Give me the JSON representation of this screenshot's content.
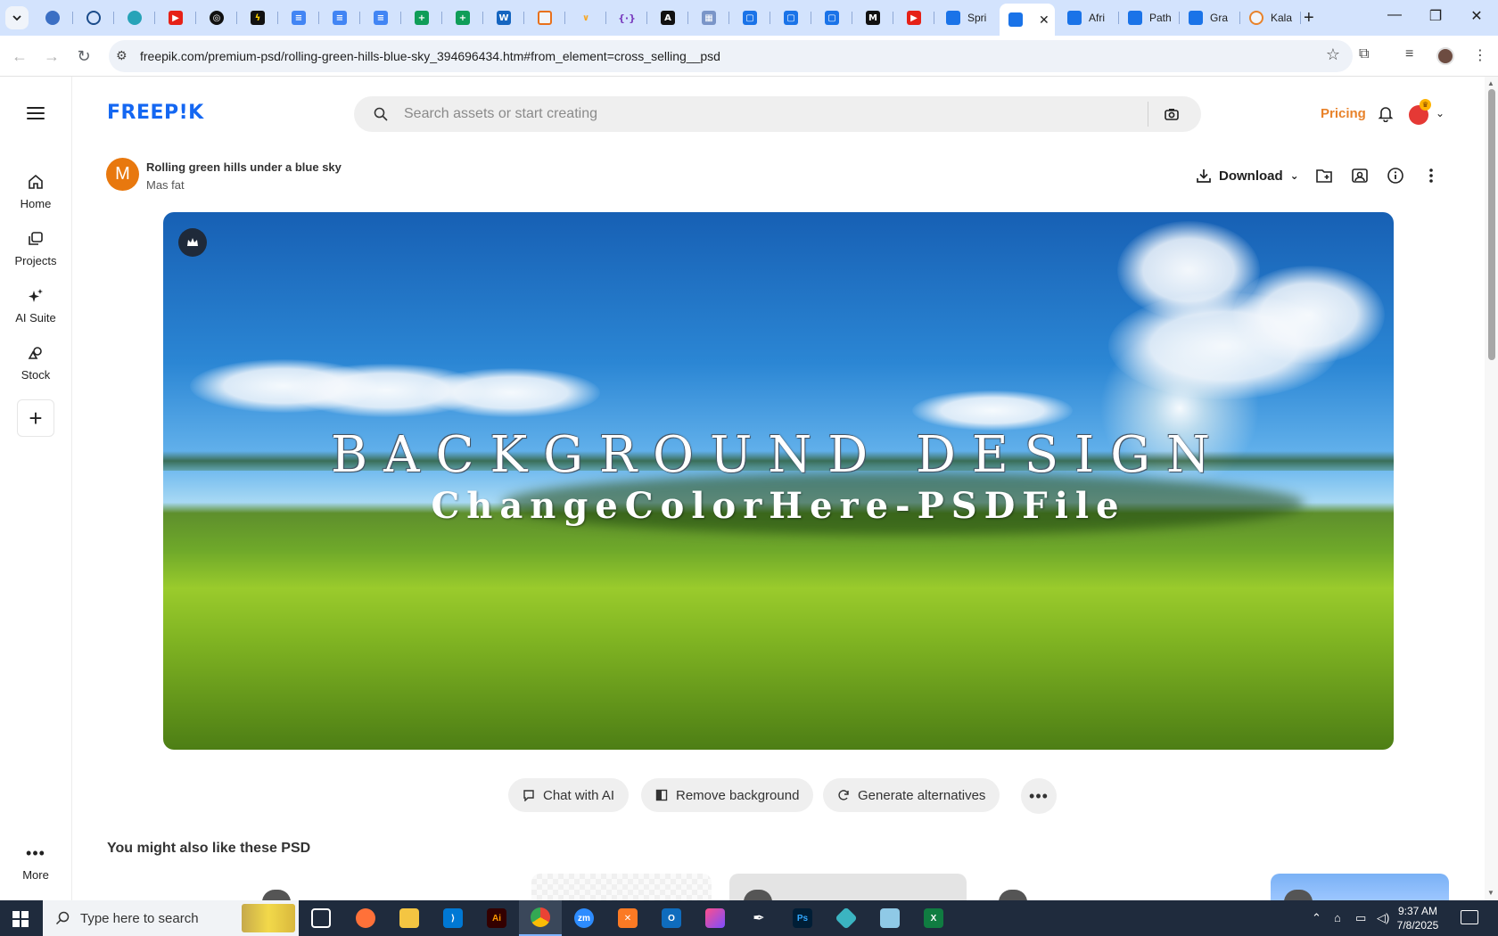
{
  "browser": {
    "tabs_labeled": [
      {
        "label": "Spri"
      },
      {
        "label": "Afri"
      },
      {
        "label": "Path"
      },
      {
        "label": "Gra"
      },
      {
        "label": "Kala"
      }
    ],
    "url": "freepik.com/premium-psd/rolling-green-hills-blue-sky_394696434.htm#from_element=cross_selling__psd"
  },
  "rail": {
    "items": [
      {
        "label": "Home",
        "icon": "home-icon"
      },
      {
        "label": "Projects",
        "icon": "projects-icon"
      },
      {
        "label": "AI Suite",
        "icon": "sparkles-icon"
      },
      {
        "label": "Stock",
        "icon": "stock-icon"
      }
    ],
    "more_label": "More"
  },
  "header": {
    "logo": "FREEP!K",
    "search_placeholder": "Search assets or start creating",
    "pricing_label": "Pricing"
  },
  "asset": {
    "author_initial": "M",
    "title": "Rolling green hills under a blue sky",
    "author": "Mas fat",
    "download_label": "Download",
    "headline": "BACKGROUND DESIGN",
    "subheadline": "ChangeColorHere-PSDFile"
  },
  "actions": {
    "chat": "Chat with AI",
    "remove_bg": "Remove background",
    "generate": "Generate alternatives",
    "more": "•••"
  },
  "section": {
    "title": "You might also like these PSD"
  },
  "taskbar": {
    "search_text": "Type here to search",
    "time": "9:37 AM",
    "date": "7/8/2025"
  },
  "colors": {
    "brand": "#1467f2",
    "pricing": "#e8822a",
    "author_avatar": "#e8780e"
  }
}
